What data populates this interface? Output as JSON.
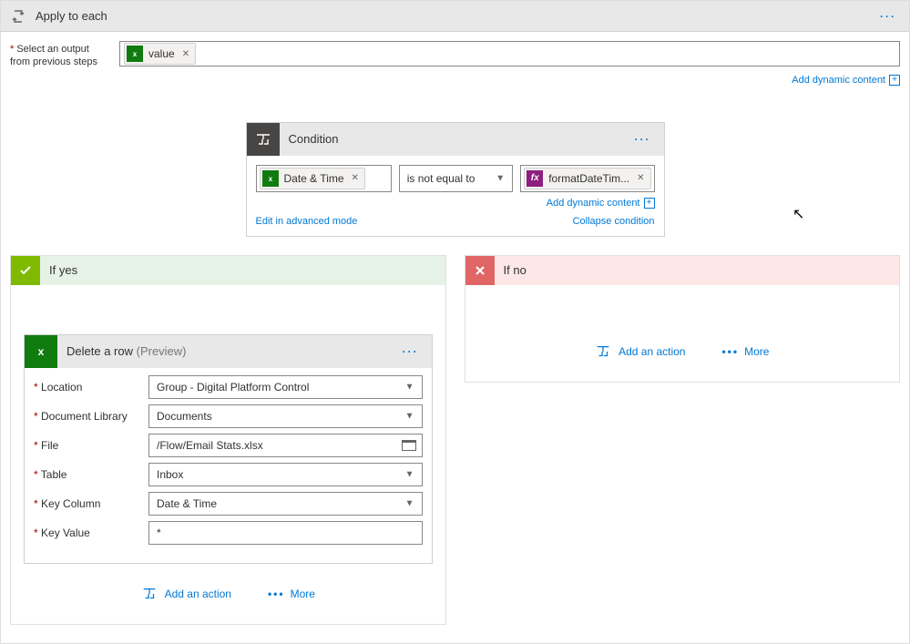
{
  "applyToEach": {
    "title": "Apply to each",
    "selectOutputLabel": "Select an output from previous steps",
    "token": {
      "label": "value"
    },
    "dynamicContent": "Add dynamic content"
  },
  "condition": {
    "title": "Condition",
    "leftToken": "Date & Time",
    "operator": "is not equal to",
    "rightToken": "formatDateTim...",
    "dynamicContent": "Add dynamic content",
    "editAdvanced": "Edit in advanced mode",
    "collapse": "Collapse condition"
  },
  "branches": {
    "yes": {
      "title": "If yes",
      "action": {
        "title": "Delete a row",
        "preview": "(Preview)",
        "fields": {
          "location": {
            "label": "Location",
            "value": "Group - Digital Platform Control"
          },
          "library": {
            "label": "Document Library",
            "value": "Documents"
          },
          "file": {
            "label": "File",
            "value": "/Flow/Email Stats.xlsx"
          },
          "table": {
            "label": "Table",
            "value": "Inbox"
          },
          "keycol": {
            "label": "Key Column",
            "value": "Date & Time"
          },
          "keyval": {
            "label": "Key Value",
            "value": "*"
          }
        }
      },
      "addAction": "Add an action",
      "more": "More"
    },
    "no": {
      "title": "If no",
      "addAction": "Add an action",
      "more": "More"
    }
  }
}
